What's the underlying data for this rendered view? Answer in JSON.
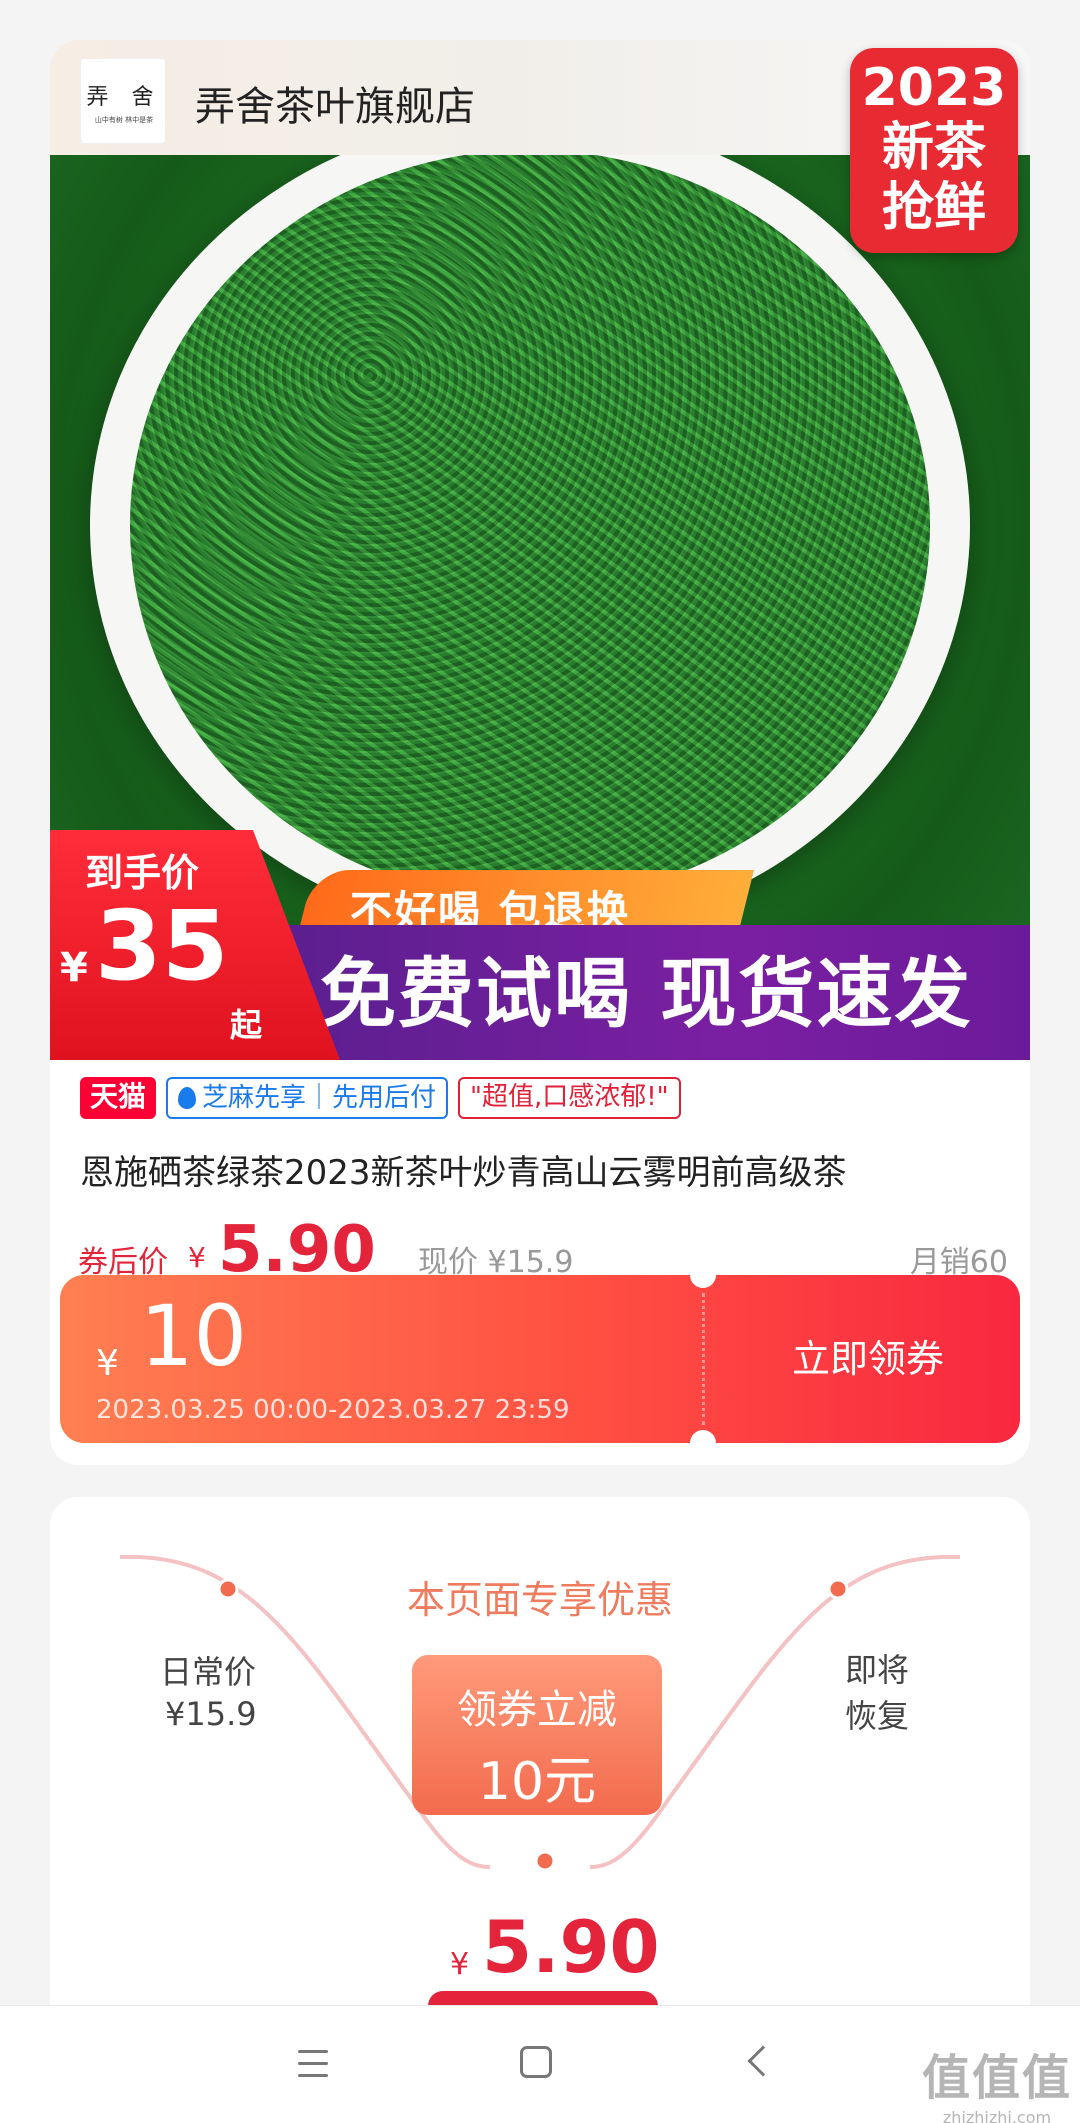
{
  "store": {
    "logo_chars": "弄 舍",
    "logo_tagline": "山中有树 林中是茶",
    "name": "弄舍茶叶旗舰店"
  },
  "product_image": {
    "badge_line1": "2023",
    "badge_line2": "新茶",
    "badge_line3": "抢鲜",
    "final_price_label": "到手价",
    "final_price_yen": "¥",
    "final_price_value": "35",
    "final_price_suffix": "起",
    "strip_text": "不好喝 包退换",
    "band_text": "免费试喝 现货速发"
  },
  "tags": {
    "tmall": "天猫",
    "zhima": "芝麻先享｜先用后付",
    "quote": "\"超值,口感浓郁!\""
  },
  "product": {
    "title": "恩施硒茶绿茶2023新茶叶炒青高山云雾明前高级茶",
    "coupon_price_label": "券后价",
    "coupon_price_yen": "¥",
    "coupon_price": "5.90",
    "current_price": "现价 ¥15.9",
    "monthly_sales": "月销60"
  },
  "coupon": {
    "yen": "¥",
    "amount": "10",
    "validity": "2023.03.25 00:00-2023.03.27 23:59",
    "button_label": "立即领券"
  },
  "exclusive": {
    "title": "本页面专享优惠",
    "daily_label": "日常价",
    "daily_price": "¥15.9",
    "reduce_line1": "领券立减",
    "reduce_line2": "10元",
    "restore_line1": "即将",
    "restore_line2": "恢复",
    "final_yen": "¥",
    "final_price": "5.90"
  },
  "watermark": {
    "big": "值值值",
    "small": "zhizhizhi.com"
  },
  "colors": {
    "accent_red": "#e4243b",
    "coupon_orange": "#ff7f52",
    "promo_purple": "#7b1fa2",
    "tmall_red": "#ff0036",
    "zhima_blue": "#1a7bea"
  }
}
